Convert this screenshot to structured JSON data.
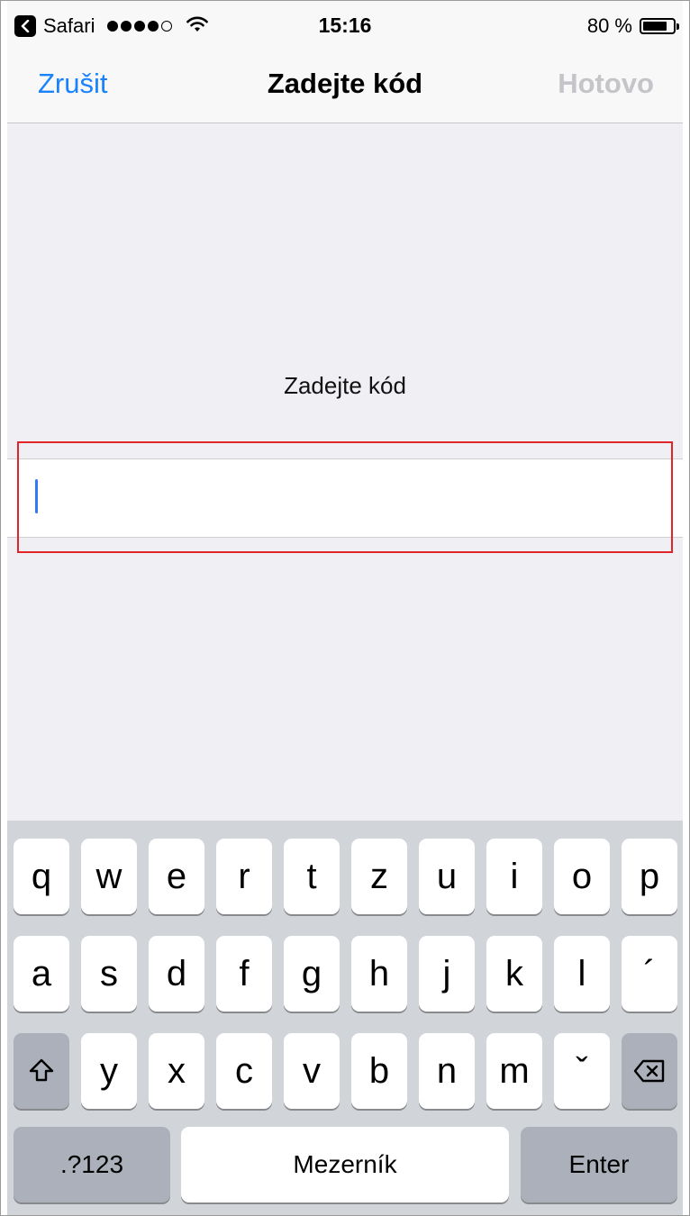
{
  "status_bar": {
    "app": "Safari",
    "signal_bars": 4,
    "signal_total": 5,
    "time": "15:16",
    "battery_percent": "80 %",
    "battery_level": 0.8
  },
  "nav": {
    "cancel": "Zrušit",
    "title": "Zadejte kód",
    "done": "Hotovo"
  },
  "content": {
    "prompt": "Zadejte kód",
    "code_value": ""
  },
  "keyboard": {
    "row1": [
      "q",
      "w",
      "e",
      "r",
      "t",
      "z",
      "u",
      "i",
      "o",
      "p"
    ],
    "row2": [
      "a",
      "s",
      "d",
      "f",
      "g",
      "h",
      "j",
      "k",
      "l",
      "´"
    ],
    "row3": [
      "y",
      "x",
      "c",
      "v",
      "b",
      "n",
      "m",
      "ˇ"
    ],
    "numbers": ".?123",
    "space": "Mezerník",
    "enter": "Enter"
  },
  "colors": {
    "accent": "#1a82fb",
    "disabled": "#c4c4c9",
    "highlight": "#e0242a",
    "caret": "#3478f6"
  }
}
